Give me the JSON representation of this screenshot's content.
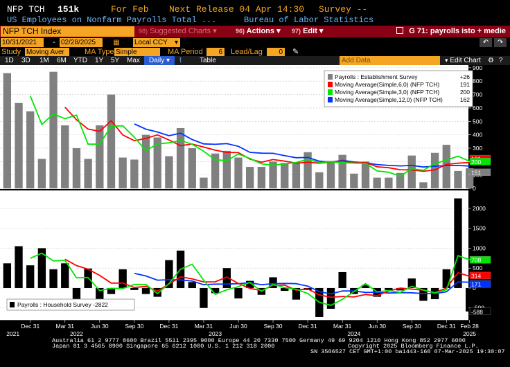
{
  "header": {
    "ticker": "NFP TCH",
    "value": "151k",
    "for_label": "For Feb",
    "next_release": "Next Release 04 Apr 14:30",
    "survey": "Survey --",
    "description": "US Employees on Nonfarm Payrolls Total ...",
    "source": "Bureau of Labor Statistics"
  },
  "toolbar": {
    "index_name": "NFP TCH Index",
    "suggested": "Suggested Charts",
    "actions_num": "96)",
    "actions": "Actions",
    "edit_num": "97)",
    "edit": "Edit",
    "chart_title": "G 71: payrolls isto + medie"
  },
  "range": {
    "start": "10/31/2021",
    "end": "02/28/2025",
    "currency": "Local CCY"
  },
  "study": {
    "label": "Study",
    "value": "Moving Aver",
    "ma_type_label": "MA Type",
    "ma_type": "Simple",
    "ma_period_label": "MA Period",
    "ma_period": "6",
    "leadlag_label": "Lead/Lag",
    "leadlag": "0"
  },
  "periods": [
    "1D",
    "3D",
    "1M",
    "6M",
    "YTD",
    "1Y",
    "5Y",
    "Max"
  ],
  "frequency": "Daily",
  "table_label": "Table",
  "add_data": "Add Data",
  "edit_chart": "Edit Chart",
  "colors": {
    "bar_top": "#808080",
    "bar_bottom": "#000000",
    "ma6": "#ff0000",
    "ma3": "#00e600",
    "ma12": "#0033ff",
    "accent": "#f3a523",
    "bar_red": "#8a0014"
  },
  "chart_data": [
    {
      "type": "bar",
      "legend": [
        {
          "name": "Payrolls : Establishment Survey",
          "value": "+26"
        },
        {
          "name": "Moving Average(Simple,6,0) (NFP TCH)",
          "value": "191"
        },
        {
          "name": "Moving Average(Simple,3,0) (NFP TCH)",
          "value": "200"
        },
        {
          "name": "Moving Average(Simple,12,0) (NFP TCH)",
          "value": "162"
        }
      ],
      "y_ticks": [
        "900",
        "800",
        "700",
        "600",
        "500",
        "400",
        "300",
        "200",
        "100",
        "0"
      ],
      "ylim": [
        -5,
        920
      ],
      "right_labels": [
        {
          "text": "191",
          "value": 191,
          "color": "#ff0000"
        },
        {
          "text": "200",
          "value": 200,
          "color": "#00e600"
        },
        {
          "text": "151",
          "value": 151,
          "color": "#808080"
        }
      ],
      "values": [
        860,
        637,
        575,
        220,
        870,
        470,
        300,
        220,
        470,
        700,
        230,
        215,
        400,
        380,
        240,
        450,
        300,
        80,
        260,
        280,
        230,
        160,
        160,
        200,
        190,
        190,
        270,
        120,
        205,
        250,
        110,
        200,
        80,
        80,
        115,
        245,
        45,
        265,
        325,
        130,
        151
      ],
      "ma6": [
        null,
        null,
        null,
        null,
        null,
        null,
        null,
        null,
        null,
        null,
        null,
        null,
        null,
        null,
        null,
        null,
        null,
        null,
        null,
        null,
        null,
        null,
        null,
        null,
        null,
        null,
        null,
        null,
        null,
        null,
        null,
        null,
        null,
        null,
        null,
        null,
        null,
        null,
        null,
        null,
        null
      ],
      "ma3": [
        null,
        null,
        null,
        null,
        null,
        null,
        null,
        null,
        null,
        null,
        null,
        null,
        null,
        null,
        null,
        null,
        null,
        null,
        null,
        null,
        null,
        null,
        null,
        null,
        null,
        null,
        null,
        null,
        null,
        null,
        null,
        null,
        null,
        null,
        null,
        null,
        null,
        null,
        null,
        null,
        null
      ],
      "ma12": [
        null,
        null,
        null,
        null,
        null,
        null,
        null,
        null,
        null,
        null,
        null,
        null,
        null,
        null,
        null,
        null,
        null,
        null,
        null,
        null,
        null,
        null,
        null,
        null,
        null,
        null,
        null,
        null,
        null,
        null,
        null,
        null,
        null,
        null,
        null,
        null,
        null,
        null,
        null,
        null,
        null
      ]
    },
    {
      "type": "bar",
      "legend": [
        {
          "name": "Payrolls : Household Survey",
          "value": "-2822"
        }
      ],
      "y_ticks": [
        "2000",
        "1500",
        "1000",
        "500",
        "0",
        "-500"
      ],
      "ylim": [
        -800,
        2450
      ],
      "right_labels": [
        {
          "text": "708",
          "value": 708,
          "color": "#00e600"
        },
        {
          "text": "314",
          "value": 314,
          "color": "#ff0000"
        },
        {
          "text": "171",
          "value": 171,
          "color": "#0033ff"
        },
        {
          "text": "-588",
          "value": -588,
          "color": "#000000"
        }
      ],
      "values": [
        620,
        1050,
        570,
        1000,
        470,
        620,
        -320,
        490,
        -360,
        -150,
        470,
        -50,
        -150,
        -220,
        700,
        940,
        150,
        -500,
        -130,
        500,
        -260,
        180,
        -170,
        270,
        -70,
        -290,
        -50,
        -730,
        -520,
        400,
        -150,
        80,
        -220,
        -50,
        -60,
        240,
        -320,
        -280,
        470,
        2250,
        -588
      ]
    }
  ],
  "x_axis": {
    "labels": [
      "Dec 31",
      "Mar 31",
      "Jun 30",
      "Sep 30",
      "Dec 31",
      "Mar 31",
      "Jun 30",
      "Sep 30",
      "Dec 31",
      "Mar 31",
      "Jun 30",
      "Sep 30",
      "Dec 31",
      "Feb 28"
    ],
    "label_index": [
      2,
      5,
      8,
      11,
      14,
      17,
      20,
      23,
      26,
      29,
      32,
      35,
      38,
      40
    ],
    "years": [
      "2021",
      "2022",
      "2023",
      "2024",
      "2025"
    ],
    "year_index": [
      0.5,
      6,
      18,
      30,
      40
    ]
  },
  "footer": {
    "line1": "Australia 61 2 9777 8600 Brazil 5511 2395 9000 Europe 44 20 7330 7500 Germany 49 69 9204 1210 Hong Kong 852 2977 6000",
    "line2a": "Japan 81 3 4565 8900         Singapore 65 6212 1000       U.S. 1 212 318 2000",
    "line2b": "Copyright 2025 Bloomberg Finance L.P.",
    "line3": "SN 3506527 CET  GMT+1:00 ba1443-160 07-Mar-2025 19:30:07"
  }
}
